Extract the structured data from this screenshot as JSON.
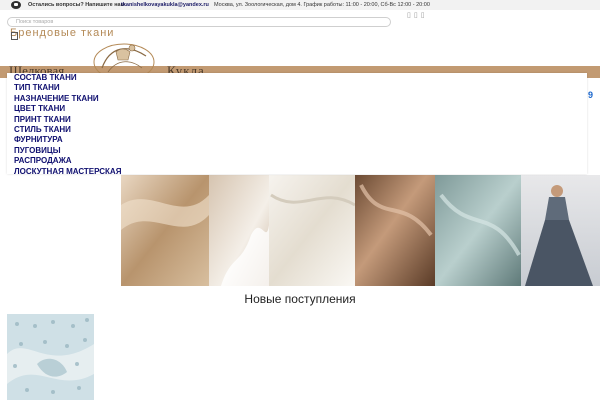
{
  "topbar": {
    "question": "Остались вопросы? Напишите нам",
    "email": "tkanishelkovayakukla@yandex.ru",
    "address": "Москва, ул. Зоологическая, дом 4. График работы: 11:00 - 20:00, Сб-Вс 12:00 - 20:00"
  },
  "search": {
    "placeholder": "Поиск товаров"
  },
  "header": {
    "brand_link": "Брендовые ткани",
    "logo_left": "Шелковая",
    "logo_right": "Кукла",
    "band_digit": "9"
  },
  "menu": {
    "items": [
      "СОСТАВ ТКАНИ",
      "ТИП ТКАНИ",
      "НАЗНАЧЕНИЕ ТКАНИ",
      "ЦВЕТ ТКАНИ",
      "ПРИНТ ТКАНИ",
      "СТИЛЬ ТКАНИ",
      "ФУРНИТУРА",
      "ПУГОВИЦЫ",
      "РАСПРОДАЖА",
      "ЛОСКУТНАЯ МАСТЕРСКАЯ"
    ]
  },
  "sections": {
    "new_arrivals": "Новые поступления"
  },
  "colors": {
    "accent": "#b48a57",
    "menu_text": "#101070",
    "logo_band": "#c29a72",
    "link_blue": "#1a66cc"
  }
}
